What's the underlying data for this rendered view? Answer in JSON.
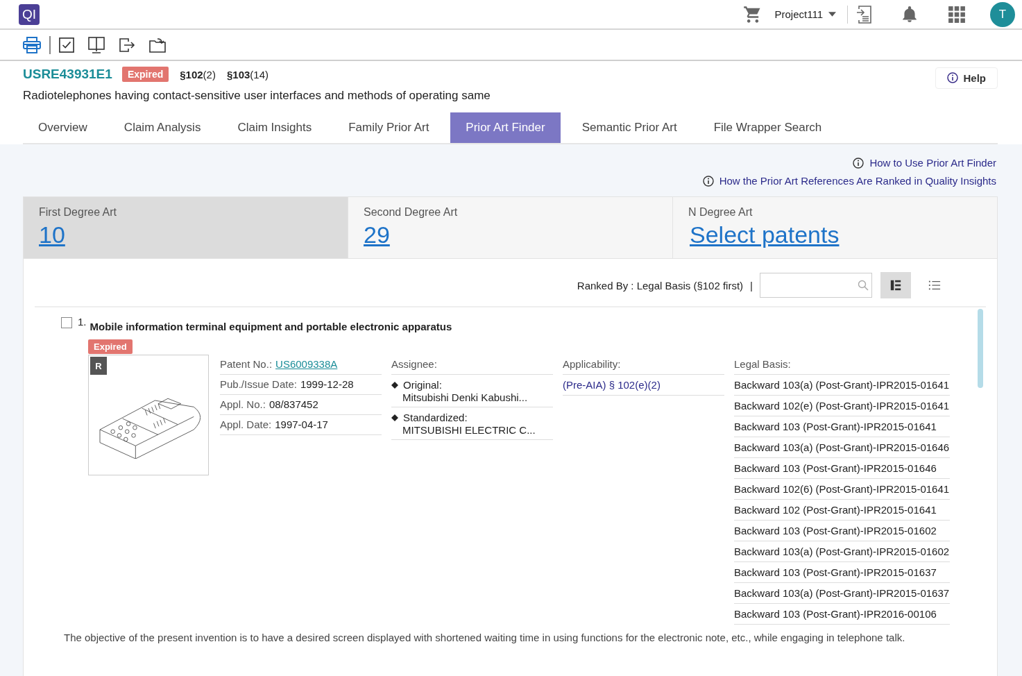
{
  "app": {
    "logo": "QI",
    "project": "Project111",
    "avatar": "T"
  },
  "patent": {
    "number": "USRE43931E1",
    "status": "Expired",
    "citations": [
      {
        "section": "§102",
        "count": "(2)"
      },
      {
        "section": "§103",
        "count": "(14)"
      }
    ],
    "title": "Radiotelephones having contact-sensitive user interfaces and methods of operating same"
  },
  "help": "Help",
  "tabs": [
    {
      "label": "Overview",
      "selected": false
    },
    {
      "label": "Claim Analysis",
      "selected": false
    },
    {
      "label": "Claim Insights",
      "selected": false
    },
    {
      "label": "Family Prior Art",
      "selected": false
    },
    {
      "label": "Prior Art Finder",
      "selected": true
    },
    {
      "label": "Semantic Prior Art",
      "selected": false
    },
    {
      "label": "File Wrapper Search",
      "selected": false
    }
  ],
  "info_links": [
    "How to Use Prior Art Finder",
    "How the Prior Art References Are Ranked in Quality Insights"
  ],
  "degree_cards": [
    {
      "label": "First Degree Art",
      "value": "10",
      "selected": true
    },
    {
      "label": "Second Degree Art",
      "value": "29",
      "selected": false
    },
    {
      "label": "N Degree Art",
      "value": "Select patents",
      "selected": false
    }
  ],
  "ranking": {
    "label": "Ranked By : Legal Basis (§102 first)",
    "separator": "|"
  },
  "view_modes": [
    {
      "kind": "detail",
      "selected": true
    },
    {
      "kind": "list",
      "selected": false
    }
  ],
  "results": [
    {
      "index": "1.",
      "checked": false,
      "title": "Mobile information terminal equipment and portable electronic apparatus",
      "status": "Expired",
      "badge": "R",
      "fields": [
        {
          "label": "Patent No.:",
          "value": "US6009338A",
          "kind": "link"
        },
        {
          "label": "Pub./Issue Date:",
          "value": "1999-12-28",
          "kind": "text"
        },
        {
          "label": "Appl. No.:",
          "value": "08/837452",
          "kind": "text"
        },
        {
          "label": "Appl. Date:",
          "value": "1997-04-17",
          "kind": "text"
        }
      ],
      "assignee": {
        "label": "Assignee:",
        "entries": [
          {
            "label": "Original:",
            "value": "Mitsubishi Denki Kabushi..."
          },
          {
            "label": "Standardized:",
            "value": "MITSUBISHI ELECTRIC C..."
          }
        ]
      },
      "applicability": {
        "label": "Applicability:",
        "values": [
          "(Pre-AIA) § 102(e)(2)"
        ]
      },
      "legal_basis": {
        "label": "Legal Basis:",
        "items": [
          "Backward 103(a) (Post-Grant)-IPR2015-01641",
          "Backward 102(e) (Post-Grant)-IPR2015-01641",
          "Backward 103 (Post-Grant)-IPR2015-01641",
          "Backward 103(a) (Post-Grant)-IPR2015-01646",
          "Backward 103 (Post-Grant)-IPR2015-01646",
          "Backward 102(6) (Post-Grant)-IPR2015-01641",
          "Backward 102 (Post-Grant)-IPR2015-01641",
          "Backward 103 (Post-Grant)-IPR2015-01602",
          "Backward 103(a) (Post-Grant)-IPR2015-01602",
          "Backward 103 (Post-Grant)-IPR2015-01637",
          "Backward 103(a) (Post-Grant)-IPR2015-01637",
          "Backward 103 (Post-Grant)-IPR2016-00106"
        ]
      },
      "abstract": "The objective of the present invention is to have a desired screen displayed with shortened waiting time in using functions for the electronic note, etc., while engaging in telephone talk."
    }
  ]
}
